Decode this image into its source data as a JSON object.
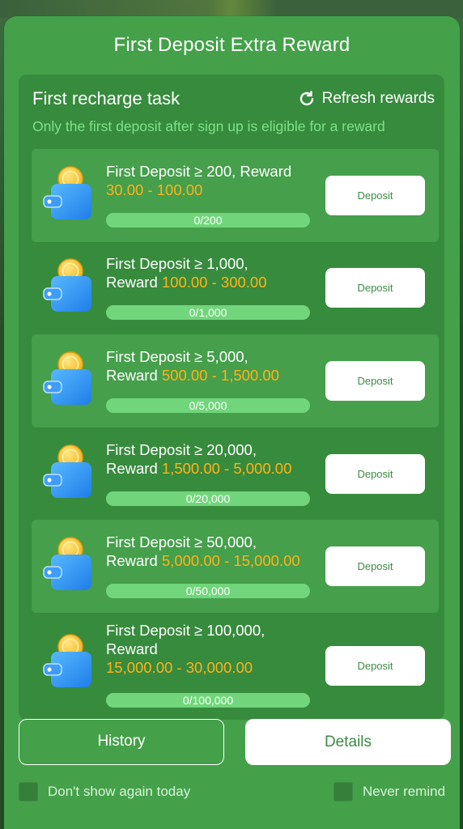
{
  "modal": {
    "title": "First Deposit Extra Reward"
  },
  "panel": {
    "title": "First recharge task",
    "refresh_label": "Refresh rewards",
    "subtitle": "Only the first deposit after sign up is eligible for a reward"
  },
  "tasks": [
    {
      "line1": "First Deposit ≥ 200, Reward",
      "line2_prefix": "",
      "reward": "30.00 - 100.00",
      "progress_text": "0/200",
      "progress": 0,
      "button": "Deposit",
      "highlight": true
    },
    {
      "line1": "First Deposit ≥ 1,000,",
      "line2_prefix": "Reward ",
      "reward": "100.00 - 300.00",
      "progress_text": "0/1,000",
      "progress": 0,
      "button": "Deposit",
      "highlight": false
    },
    {
      "line1": "First Deposit ≥ 5,000,",
      "line2_prefix": "Reward ",
      "reward": "500.00 - 1,500.00",
      "progress_text": "0/5,000",
      "progress": 0,
      "button": "Deposit",
      "highlight": true
    },
    {
      "line1": "First Deposit ≥ 20,000,",
      "line2_prefix": "Reward ",
      "reward": "1,500.00 - 5,000.00",
      "progress_text": "0/20,000",
      "progress": 0,
      "button": "Deposit",
      "highlight": false
    },
    {
      "line1": "First Deposit ≥ 50,000,",
      "line2_prefix": "Reward ",
      "reward": "5,000.00 - 15,000.00",
      "progress_text": "0/50,000",
      "progress": 0,
      "button": "Deposit",
      "highlight": true
    },
    {
      "line1": "First Deposit ≥ 100,000,",
      "line2_prefix": "Reward",
      "reward": "15,000.00 - 30,000.00",
      "progress_text": "0/100,000",
      "progress": 0,
      "button": "Deposit",
      "highlight": false
    }
  ],
  "footer": {
    "history_label": "History",
    "details_label": "Details",
    "dont_show_label": "Don't show again today",
    "never_remind_label": "Never remind"
  },
  "colors": {
    "modal_bg": "#44a14a",
    "panel_bg": "#378b3d",
    "subtitle": "#7de38a",
    "reward_amount": "#ffb21a",
    "progress_track": "#71d67b"
  },
  "icons": {
    "refresh": "refresh-icon",
    "wallet": "wallet-coin-icon",
    "checkbox": "checkbox-icon"
  }
}
